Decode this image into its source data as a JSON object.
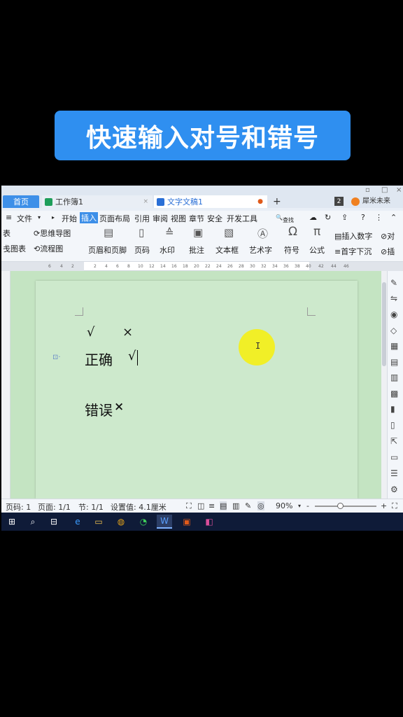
{
  "banner": {
    "title": "快速输入对号和错号"
  },
  "tabs": {
    "home": "首页",
    "workbook": "工作簿1",
    "document": "文字文稿1",
    "add": "+",
    "close": "×",
    "badge": "2",
    "user": "犀米未来"
  },
  "window_controls": [
    "▫",
    "□",
    "×"
  ],
  "menu": {
    "file": "文件",
    "items": [
      "开始",
      "插入",
      "页面布局",
      "引用",
      "审阅",
      "视图",
      "章节",
      "安全",
      "开发工具"
    ],
    "active": "插入",
    "search": "查找"
  },
  "ribbon": {
    "left_cut_top": "表",
    "left_cut_bottom": "戋图表",
    "mindmap": "思维导图",
    "flowchart": "流程图",
    "header_footer": "页眉和页脚",
    "page_number": "页码",
    "watermark": "水印",
    "comment": "批注",
    "textbox": "文本框",
    "wordart": "艺术字",
    "symbol": "符号",
    "formula": "公式",
    "insert_number": "插入数字",
    "drop_cap": "首字下沉",
    "cut_right_top": "对",
    "cut_right_bottom": "插"
  },
  "ruler": [
    "6",
    "4",
    "2",
    "2",
    "4",
    "6",
    "8",
    "10",
    "12",
    "14",
    "16",
    "18",
    "20",
    "22",
    "24",
    "26",
    "28",
    "30",
    "32",
    "34",
    "36",
    "38",
    "40",
    "42",
    "44",
    "46"
  ],
  "document": {
    "check_mark": "√",
    "cross_mark": "×",
    "line1_label": "正确",
    "line1_mark": "√",
    "line2_label": "错误",
    "line2_mark": "×"
  },
  "status": {
    "page": "页码: 1",
    "pages": "页面: 1/1",
    "section": "节: 1/1",
    "setting": "设置值: 4.1厘米",
    "zoom": "90%",
    "zoom_minus": "-",
    "zoom_plus": "+"
  },
  "colors": {
    "banner": "#2f8ff0",
    "page_bg": "#cde9cc",
    "highlight": "#f2ef1e",
    "accent": "#3d8fe8"
  }
}
